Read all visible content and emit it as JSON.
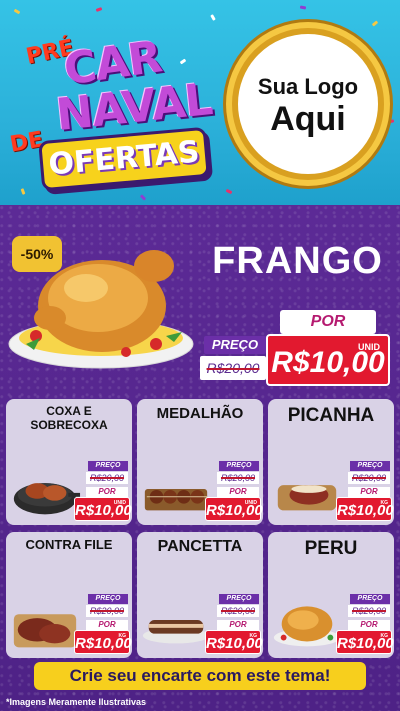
{
  "header": {
    "logo": {
      "pre": "PRÉ",
      "car": "CAR",
      "naval": "NAVAL",
      "de": "DE",
      "ofertas": "OFERTAS"
    },
    "brand_placeholder": {
      "line1": "Sua Logo",
      "line2": "Aqui"
    }
  },
  "hero": {
    "discount": "-50%",
    "title": "FRANGO",
    "preco_label": "PREÇO",
    "old_price": "R$20,00",
    "por_label": "POR",
    "unit": "UNID",
    "price": "R$10,00",
    "image_icon": "roast-chicken-icon"
  },
  "products": [
    {
      "name": "COXA E SOBRECOXA",
      "preco_label": "PREÇO",
      "old_price": "R$20,00",
      "por_label": "POR",
      "unit": "UNID",
      "price": "R$10,00",
      "icon": "chicken-legs-pan-icon"
    },
    {
      "name": "MEDALHÃO",
      "preco_label": "PREÇO",
      "old_price": "R$20,00",
      "por_label": "POR",
      "unit": "UNID",
      "price": "R$10,00",
      "icon": "medallion-skewers-icon"
    },
    {
      "name": "PICANHA",
      "preco_label": "PREÇO",
      "old_price": "R$20,00",
      "por_label": "POR",
      "unit": "KG",
      "price": "R$10,00",
      "icon": "picanha-board-icon"
    },
    {
      "name": "CONTRA FILE",
      "preco_label": "PREÇO",
      "old_price": "R$20,00",
      "por_label": "POR",
      "unit": "KG",
      "price": "R$10,00",
      "icon": "steak-board-icon"
    },
    {
      "name": "PANCETTA",
      "preco_label": "PREÇO",
      "old_price": "R$20,00",
      "por_label": "POR",
      "unit": "KG",
      "price": "R$10,00",
      "icon": "pancetta-icon"
    },
    {
      "name": "PERU",
      "preco_label": "PREÇO",
      "old_price": "R$20,00",
      "por_label": "POR",
      "unit": "KG",
      "price": "R$10,00",
      "icon": "roast-turkey-icon"
    }
  ],
  "cta": "Crie seu encarte com este tema!",
  "disclaimer": "*Imagens Meramente Ilustrativas",
  "colors": {
    "header_bg": "#2bb0d9",
    "body_bg": "#5a2a8f",
    "price_red": "#e2192f",
    "accent_yellow": "#f7cf1d",
    "card_bg": "#d9d2e6"
  }
}
